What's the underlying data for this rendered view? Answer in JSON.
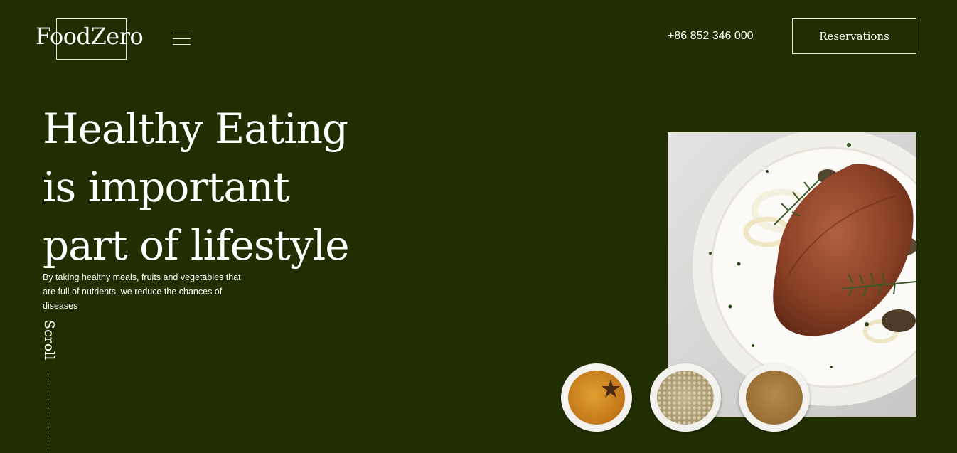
{
  "header": {
    "logo_text": "FoodZero",
    "menu_icon": "hamburger-menu-icon",
    "phone": "+86 852 346 000",
    "reservations_label": "Reservations"
  },
  "hero": {
    "title_lines": [
      "Healthy Eating",
      "is important",
      "part of lifestyle"
    ],
    "description": "By taking healthy meals, fruits and vegetables that are full of nutrients, we reduce the chances of diseases",
    "scroll_label": "Scroll"
  },
  "images": {
    "main_dish": "steak-plate-image",
    "spice_bowls": [
      "turmeric-star-anise-bowl",
      "white-peppercorn-bowl",
      "ground-spice-bowl"
    ]
  },
  "colors": {
    "background": "#212f00",
    "text": "#ffffff",
    "border": "#e8e8e0"
  }
}
